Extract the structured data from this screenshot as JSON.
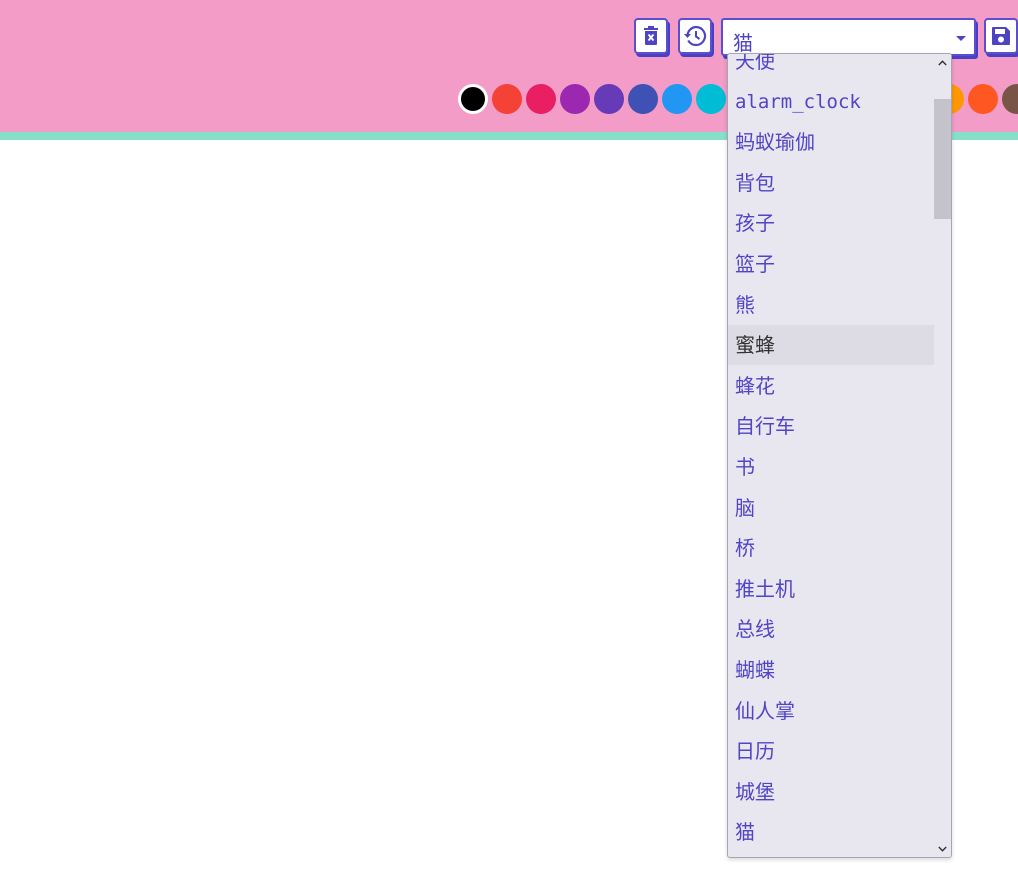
{
  "toolbar": {
    "clear_icon": "trash-x-icon",
    "history_icon": "history-icon",
    "save_icon": "floppy-disk-icon",
    "accent_color": "#5a4fcf"
  },
  "category_select": {
    "selected_value": "猫",
    "options": [
      "天使",
      "alarm_clock",
      "蚂蚁瑜伽",
      "背包",
      "孩子",
      "篮子",
      "熊",
      "蜜蜂",
      "蜂花",
      "自行车",
      "书",
      "脑",
      "桥",
      "推土机",
      "总线",
      "蝴蝶",
      "仙人掌",
      "日历",
      "城堡",
      "猫"
    ],
    "hovered_option": "蜜蜂"
  },
  "palette": {
    "selected_color": "#000000",
    "colors": [
      "#000000",
      "#f44336",
      "#e91e63",
      "#9c27b0",
      "#673ab7",
      "#3f51b5",
      "#2196f3",
      "#00bcd4",
      "#ff9800",
      "#ff5722",
      "#795548"
    ]
  },
  "theme": {
    "header_bg": "#f29cc7",
    "header_stripe": "#86dfc9",
    "canvas_bg": "#ffffff"
  }
}
